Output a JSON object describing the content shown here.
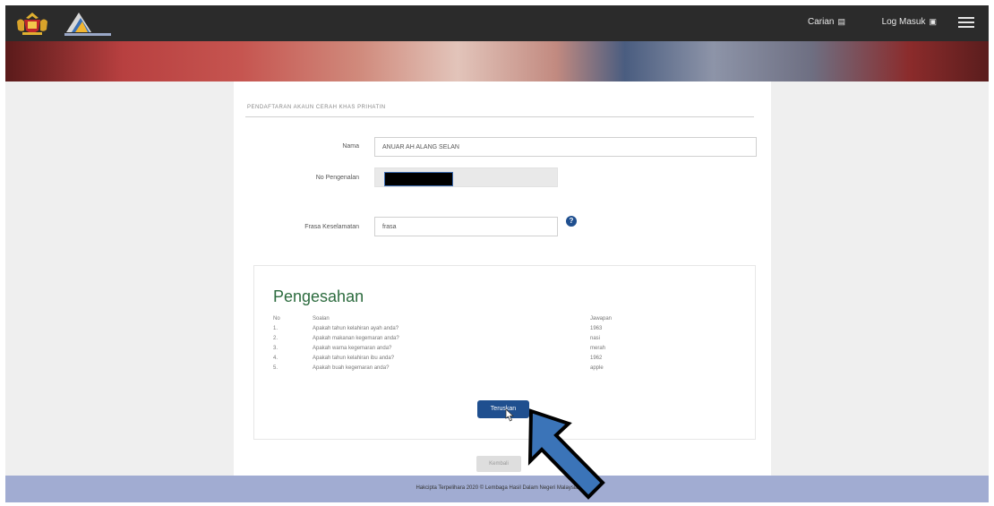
{
  "header": {
    "nav": [
      {
        "label": "Carian",
        "icon": "search-icon"
      },
      {
        "label": "Log Masuk",
        "icon": "user-icon"
      }
    ]
  },
  "page": {
    "title": "PENDAFTARAN AKAUN CERAH KHAS PRIHATIN"
  },
  "form": {
    "nama_label": "Nama",
    "nama_value": "ANUAR AH ALANG SELAN",
    "no_pengenalan_label": "No Pengenalan",
    "frasa_label": "Frasa Keselamatan",
    "frasa_value": "frasa"
  },
  "pengesahan": {
    "title": "Pengesahan",
    "headers": {
      "no": "No",
      "soalan": "Soalan",
      "jawapan": "Jawapan"
    },
    "rows": [
      {
        "no": "1.",
        "soalan": "Apakah tahun kelahiran ayah anda?",
        "jawapan": "1963"
      },
      {
        "no": "2.",
        "soalan": "Apakah makanan kegemaran anda?",
        "jawapan": "nasi"
      },
      {
        "no": "3.",
        "soalan": "Apakah warna kegemaran anda?",
        "jawapan": "merah"
      },
      {
        "no": "4.",
        "soalan": "Apakah tahun kelahiran ibu anda?",
        "jawapan": "1962"
      },
      {
        "no": "5.",
        "soalan": "Apakah buah kegemaran anda?",
        "jawapan": "apple"
      }
    ],
    "next_label": "Teruskan"
  },
  "back_label": "Kembali",
  "footer": {
    "text": "Hakcipta Terpelihara 2020 © Lembaga Hasil Dalam Negeri Malaysia"
  },
  "colors": {
    "primary": "#1f4f8f",
    "header_bg": "#2b2b2b",
    "footer_bg": "#a1acd2",
    "heading_green": "#2c6b3e",
    "arrow_fill": "#3b74b8"
  }
}
